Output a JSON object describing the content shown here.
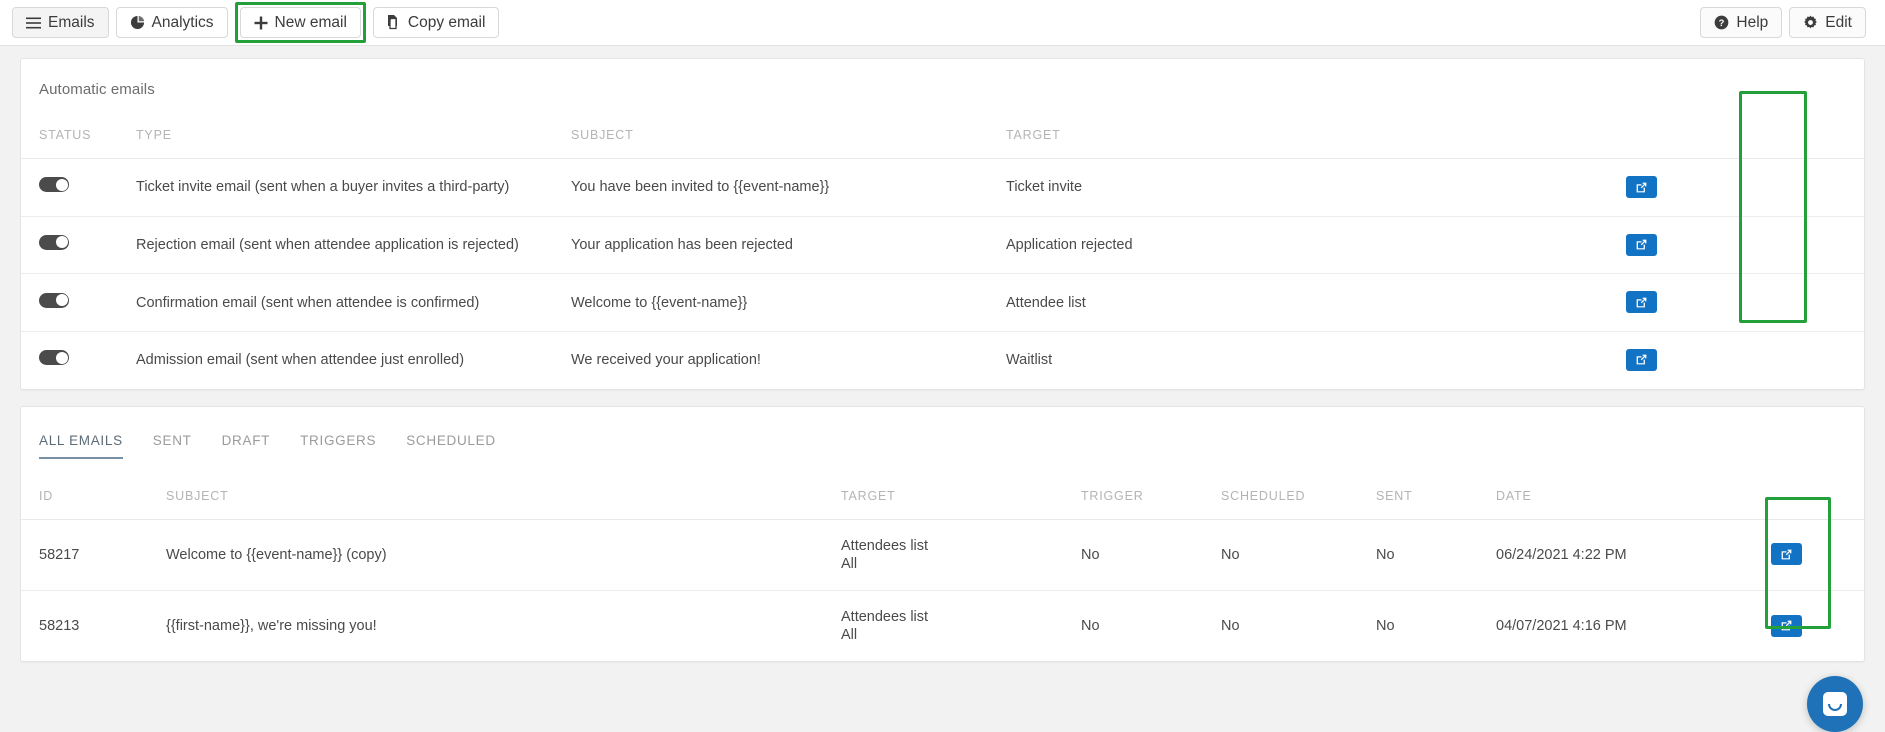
{
  "toolbar": {
    "left_buttons": [
      {
        "label": "Emails",
        "icon": "hamburger-menu-icon",
        "highlighted": false
      },
      {
        "label": "Analytics",
        "icon": "pie-chart-icon",
        "highlighted": false
      },
      {
        "label": "New email",
        "icon": "plus-icon",
        "highlighted": true
      },
      {
        "label": "Copy email",
        "icon": "copy-icon",
        "highlighted": false
      }
    ],
    "right_buttons": [
      {
        "label": "Help",
        "icon": "help-circle-icon"
      },
      {
        "label": "Edit",
        "icon": "gear-icon"
      }
    ]
  },
  "automatic_emails": {
    "title": "Automatic emails",
    "columns": [
      "STATUS",
      "TYPE",
      "SUBJECT",
      "TARGET",
      ""
    ],
    "rows": [
      {
        "status_on": true,
        "type": "Ticket invite email (sent when a buyer invites a third-party)",
        "subject": "You have been invited to {{event-name}}",
        "target": "Ticket invite",
        "action": "edit"
      },
      {
        "status_on": true,
        "type": "Rejection email (sent when attendee application is rejected)",
        "subject": "Your application has been rejected",
        "target": "Application rejected",
        "action": "edit"
      },
      {
        "status_on": true,
        "type": "Confirmation email (sent when attendee is confirmed)",
        "subject": "Welcome to {{event-name}}",
        "target": "Attendee list",
        "action": "edit"
      },
      {
        "status_on": true,
        "type": "Admission email (sent when attendee just enrolled)",
        "subject": "We received your application!",
        "target": "Waitlist",
        "action": "edit"
      }
    ]
  },
  "emails_list": {
    "tabs": [
      {
        "label": "ALL EMAILS",
        "active": true
      },
      {
        "label": "SENT",
        "active": false
      },
      {
        "label": "DRAFT",
        "active": false
      },
      {
        "label": "TRIGGERS",
        "active": false
      },
      {
        "label": "SCHEDULED",
        "active": false
      }
    ],
    "columns": [
      "ID",
      "SUBJECT",
      "TARGET",
      "TRIGGER",
      "SCHEDULED",
      "SENT",
      "DATE",
      ""
    ],
    "rows": [
      {
        "id": "58217",
        "subject": "Welcome to {{event-name}} (copy)",
        "target_line1": "Attendees list",
        "target_line2": "All",
        "trigger": "No",
        "scheduled": "No",
        "sent": "No",
        "date": "06/24/2021 4:22 PM",
        "action": "edit"
      },
      {
        "id": "58213",
        "subject": "{{first-name}}, we're missing you!",
        "target_line1": "Attendees list",
        "target_line2": "All",
        "trigger": "No",
        "scheduled": "No",
        "sent": "No",
        "date": "04/07/2021 4:16 PM",
        "action": "edit"
      }
    ]
  },
  "chat_widget": {
    "icon": "chat-smiley-icon"
  },
  "colors": {
    "highlight_green": "#24a03b",
    "action_blue": "#1272c4",
    "tab_active": "#7790a6",
    "chat_blue": "#1f72b8"
  }
}
